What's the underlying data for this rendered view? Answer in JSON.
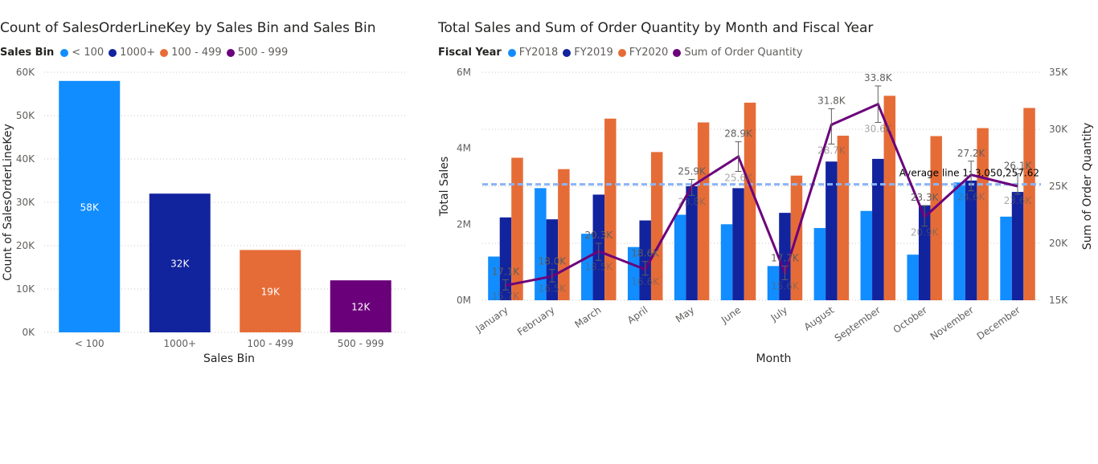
{
  "chart_data": [
    {
      "type": "bar",
      "title": "Count of SalesOrderLineKey by Sales Bin and Sales Bin",
      "legend_title": "Sales Bin",
      "categories": [
        "< 100",
        "1000+",
        "100 - 499",
        "500 - 999"
      ],
      "values": [
        58000,
        32000,
        19000,
        12000
      ],
      "data_labels": [
        "58K",
        "32K",
        "19K",
        "12K"
      ],
      "colors": [
        "#118DFF",
        "#12239E",
        "#E66C37",
        "#6B007B"
      ],
      "xlabel": "Sales Bin",
      "ylabel": "Count of SalesOrderLineKey",
      "ylim": [
        0,
        60000
      ],
      "yticks": [
        0,
        10000,
        20000,
        30000,
        40000,
        50000,
        60000
      ],
      "ytick_labels": [
        "0K",
        "10K",
        "20K",
        "30K",
        "40K",
        "50K",
        "60K"
      ],
      "legend_position": "top-left",
      "grid": true
    },
    {
      "type": "bar",
      "title": "Total Sales and Sum of Order Quantity by Month and Fiscal Year",
      "legend_title": "Fiscal Year",
      "categories": [
        "January",
        "February",
        "March",
        "April",
        "May",
        "June",
        "July",
        "August",
        "September",
        "October",
        "November",
        "December"
      ],
      "series": [
        {
          "name": "FY2018",
          "color": "#118DFF",
          "values": [
            1150000,
            2950000,
            1750000,
            1400000,
            2250000,
            2000000,
            900000,
            1900000,
            2350000,
            1200000,
            3100000,
            2200000
          ]
        },
        {
          "name": "FY2019",
          "color": "#12239E",
          "values": [
            2180000,
            2130000,
            2780000,
            2100000,
            3000000,
            2950000,
            2300000,
            3650000,
            3720000,
            2500000,
            3150000,
            2850000
          ]
        },
        {
          "name": "FY2020",
          "color": "#E66C37",
          "values": [
            3750000,
            3450000,
            4780000,
            3900000,
            4680000,
            5200000,
            3280000,
            4330000,
            5380000,
            4320000,
            4530000,
            5060000
          ]
        }
      ],
      "line_series": {
        "name": "Sum of Order Quantity",
        "color": "#6B007B",
        "values": [
          16300,
          17100,
          19300,
          17700,
          25000,
          27600,
          17400,
          30400,
          32200,
          22300,
          26000,
          25000
        ],
        "error_high": [
          16800,
          17700,
          20000,
          18400,
          25600,
          28900,
          18000,
          31800,
          33800,
          23300,
          27200,
          26100
        ],
        "error_low": [
          15900,
          16600,
          18500,
          17200,
          24200,
          26300,
          16800,
          28700,
          30600,
          21500,
          24600,
          24300
        ]
      },
      "error_labels": [
        {
          "index": 0,
          "labels": [
            "17.1K",
            "15.7K"
          ]
        },
        {
          "index": 1,
          "labels": [
            "18.0K",
            "16.5K"
          ]
        },
        {
          "index": 2,
          "labels": [
            "20.3K",
            "18.5K"
          ]
        },
        {
          "index": 3,
          "labels": [
            "18.6K",
            "16.6K"
          ]
        },
        {
          "index": 4,
          "labels": [
            "25.9K",
            "23.8K"
          ]
        },
        {
          "index": 5,
          "labels": [
            "28.9K",
            "25.6K"
          ]
        },
        {
          "index": 6,
          "labels": [
            "17.7K",
            "15.6K"
          ]
        },
        {
          "index": 7,
          "labels": [
            "31.8K",
            "28.7K"
          ]
        },
        {
          "index": 8,
          "labels": [
            "33.8K",
            "30.6K"
          ]
        },
        {
          "index": 9,
          "labels": [
            "23.3K",
            "20.9K"
          ]
        },
        {
          "index": 10,
          "labels": [
            "27.2K",
            "24.6K"
          ]
        },
        {
          "index": 11,
          "labels": [
            "26.1K",
            "23.6K"
          ]
        }
      ],
      "average_line": {
        "label": "Average line 1: 3,050,257.62",
        "value": 3050257.62,
        "color": "#8AB4F8"
      },
      "xlabel": "Month",
      "ylabel": "Total Sales",
      "y2label": "Sum of Order Quantity",
      "ylim": [
        0,
        6000000
      ],
      "yticks": [
        0,
        2000000,
        4000000,
        6000000
      ],
      "ytick_labels": [
        "0M",
        "2M",
        "4M",
        "6M"
      ],
      "y2lim": [
        15000,
        35000
      ],
      "y2ticks": [
        15000,
        20000,
        25000,
        30000,
        35000
      ],
      "y2tick_labels": [
        "15K",
        "20K",
        "25K",
        "30K",
        "35K"
      ],
      "legend_position": "top-left",
      "grid": true
    }
  ]
}
